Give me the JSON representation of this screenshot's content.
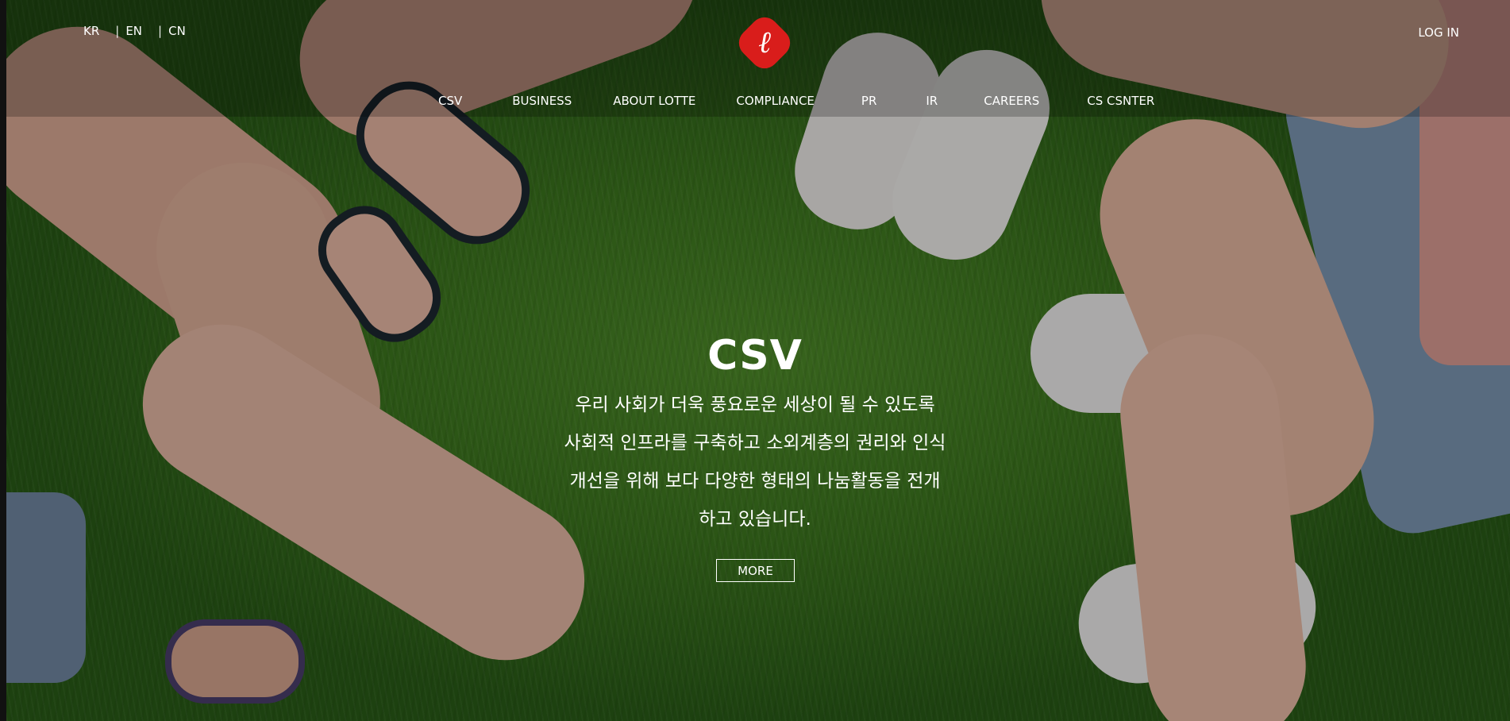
{
  "header": {
    "languages": [
      "KR",
      "EN",
      "CN"
    ],
    "logo": "lotte-logo",
    "login_label": "LOG IN",
    "menu": [
      "CSV",
      "BUSINESS",
      "ABOUT LOTTE",
      "COMPLIANCE",
      "PR",
      "IR",
      "CAREERS",
      "CS CSNTER"
    ]
  },
  "hero": {
    "title": "CSV",
    "description_lines": [
      "우리 사회가 더욱 풍요로운 세상이 될 수 있도록",
      "사회적 인프라를 구축하고 소외계층의 권리와 인식",
      "개선을 위해 보다 다양한 형태의 나눔활동을 전개",
      "하고 있습니다."
    ],
    "more_label": "MORE"
  },
  "colors": {
    "logo_red": "#d91d1b",
    "text": "#ffffff"
  }
}
